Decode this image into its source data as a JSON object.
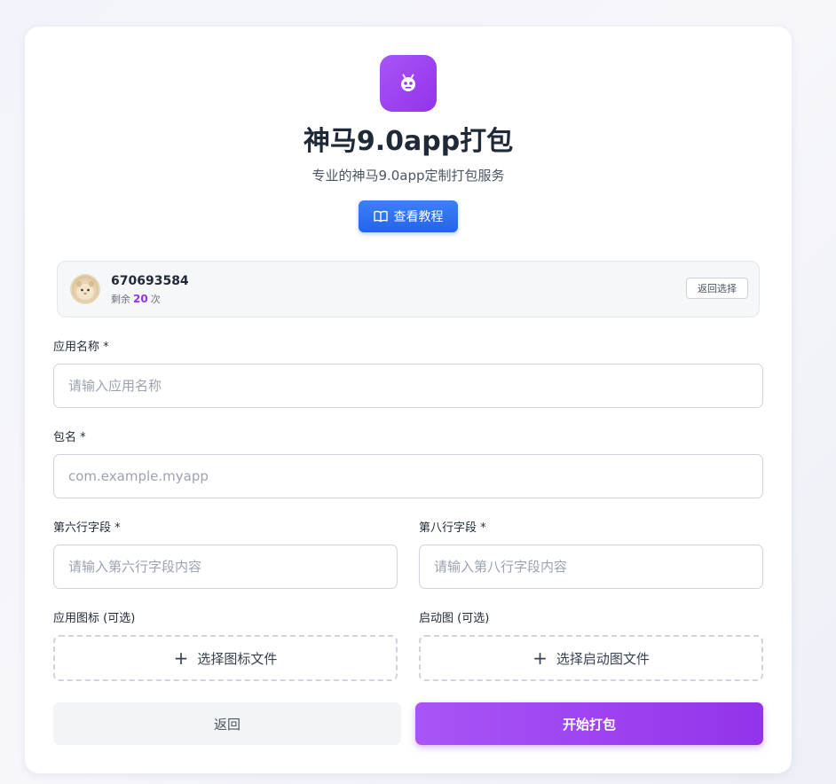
{
  "header": {
    "logo_icon": "robot-icon",
    "title": "神马9.0app打包",
    "subtitle": "专业的神马9.0app定制打包服务",
    "tutorial_button": "查看教程",
    "tutorial_icon": "book-open-icon"
  },
  "user": {
    "id": "670693584",
    "remaining_prefix": "剩余",
    "remaining_count": "20",
    "remaining_suffix": "次",
    "back_select_button": "返回选择"
  },
  "form": {
    "app_name": {
      "label": "应用名称 *",
      "placeholder": "请输入应用名称",
      "value": ""
    },
    "package_name": {
      "label": "包名 *",
      "placeholder": "com.example.myapp",
      "value": ""
    },
    "row6": {
      "label": "第六行字段 *",
      "placeholder": "请输入第六行字段内容",
      "value": ""
    },
    "row8": {
      "label": "第八行字段 *",
      "placeholder": "请输入第八行字段内容",
      "value": ""
    },
    "app_icon": {
      "label": "应用图标 (可选)",
      "button": "选择图标文件"
    },
    "splash": {
      "label": "启动图 (可选)",
      "button": "选择启动图文件"
    }
  },
  "actions": {
    "back": "返回",
    "start": "开始打包"
  },
  "colors": {
    "accent_purple": "#9333ea",
    "accent_blue": "#2563eb",
    "background": "#f5f5fb"
  }
}
